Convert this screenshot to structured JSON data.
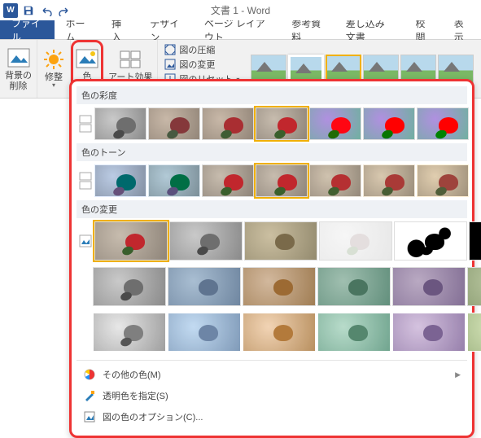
{
  "title": "文書 1 - Word",
  "tabs": {
    "file": "ファイル",
    "home": "ホーム",
    "insert": "挿入",
    "design": "デザイン",
    "layout": "ページ レイアウト",
    "refs": "参考資料",
    "mail": "差し込み文書",
    "review": "校閲",
    "view": "表示"
  },
  "groups": {
    "removebg": "背景の\n削除",
    "corrections": "修整",
    "color": "色",
    "artistic": "アート効果",
    "compress": "図の圧縮",
    "change": "図の変更",
    "reset": "図のリセット"
  },
  "dropdown": {
    "saturation": "色の彩度",
    "tone": "色のトーン",
    "recolor": "色の変更",
    "more": "その他の色(M)",
    "transparent": "透明色を指定(S)",
    "options": "図の色のオプション(C)..."
  }
}
